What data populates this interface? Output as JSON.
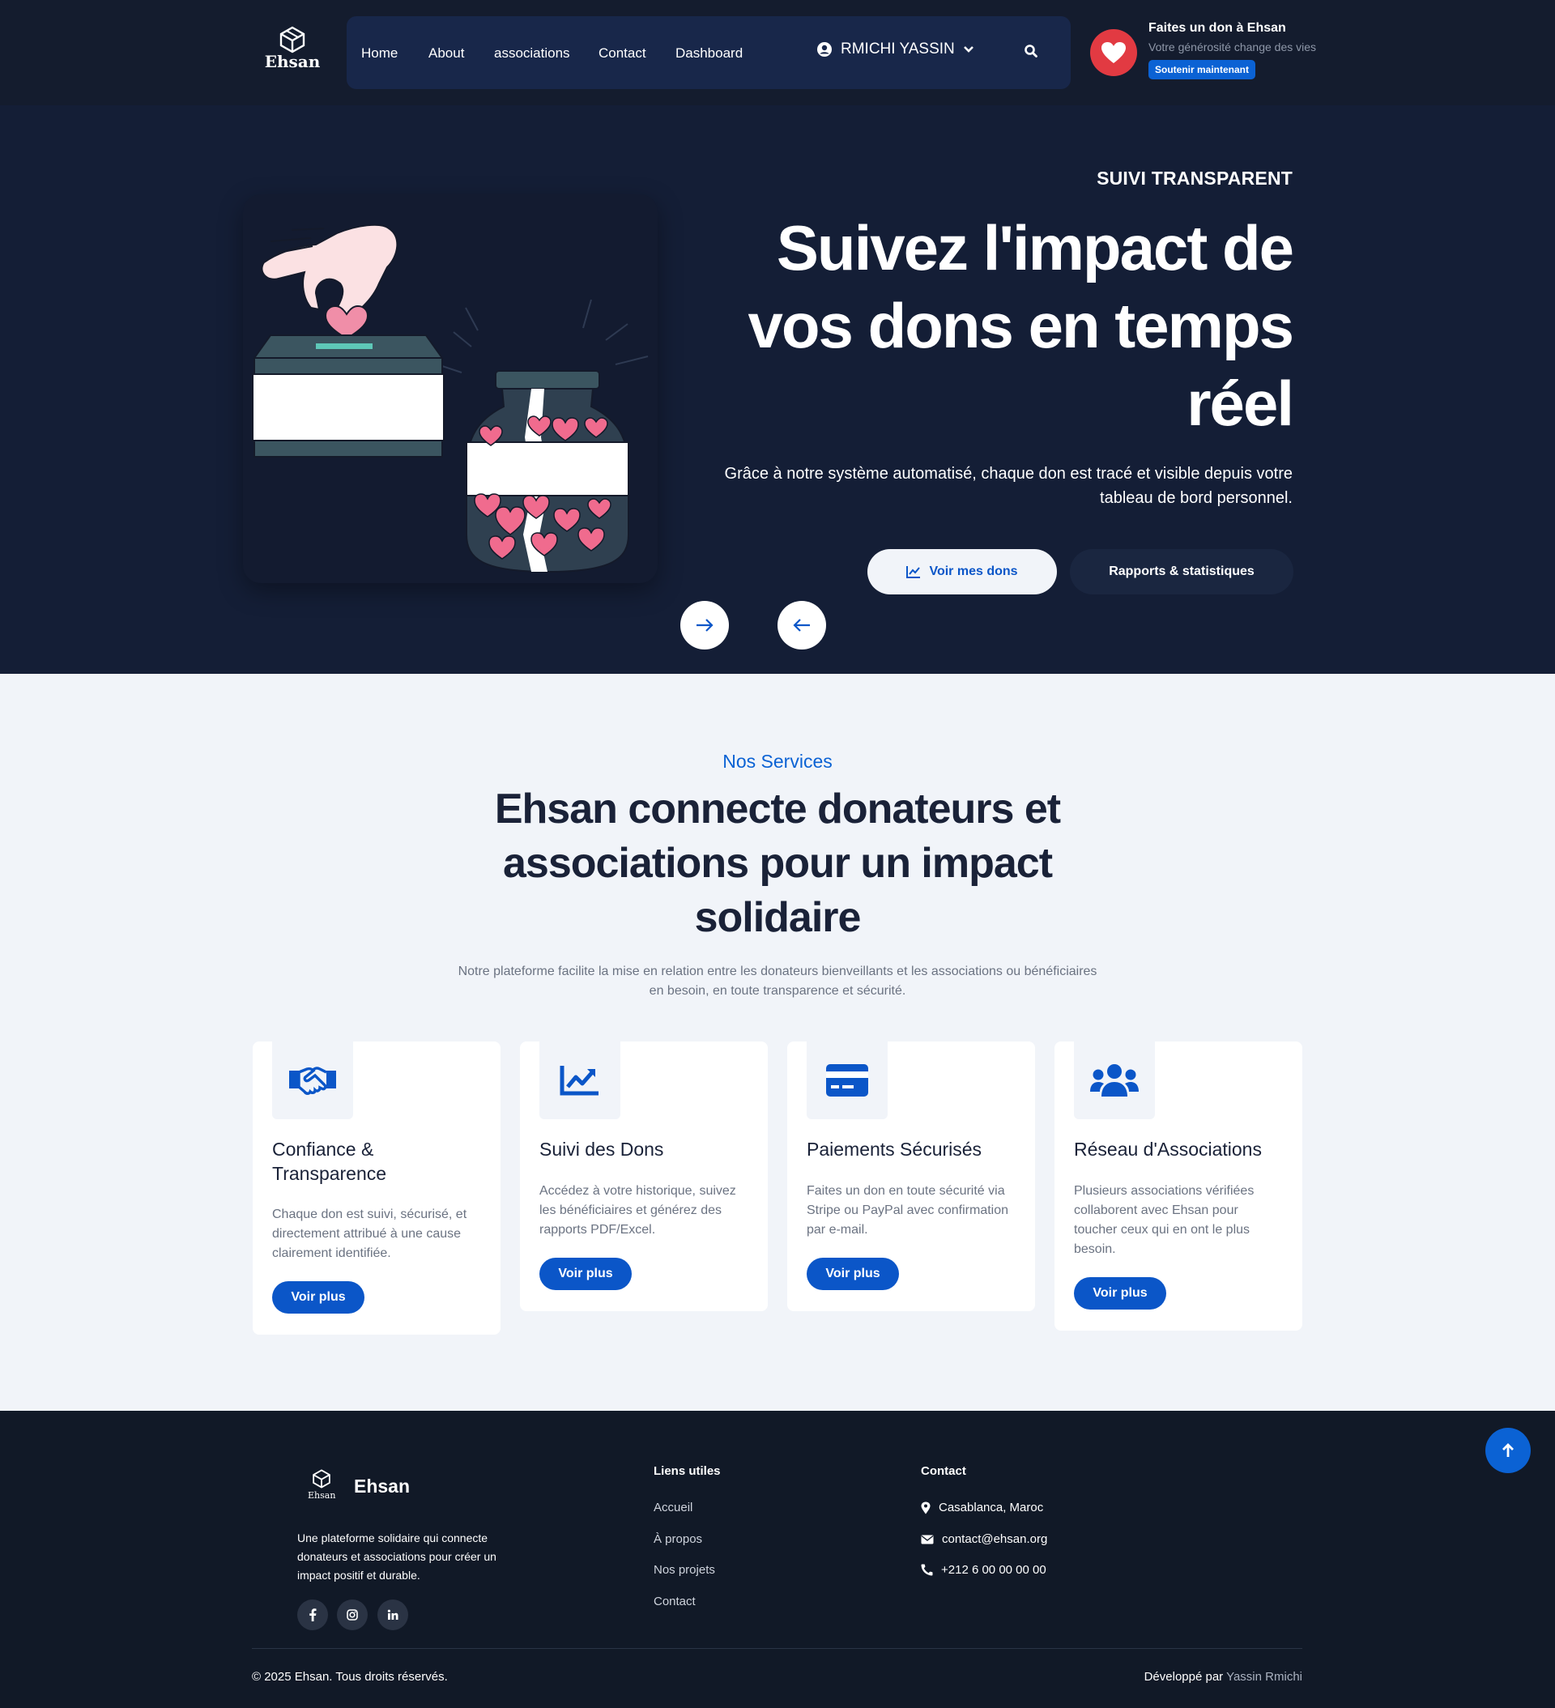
{
  "header": {
    "logo_text": "Ehsan",
    "nav": [
      "Home",
      "About",
      "associations",
      "Contact",
      "Dashboard"
    ],
    "user_name": "RMICHI YASSIN",
    "donate": {
      "title": "Faites un don à Ehsan",
      "subtitle": "Votre générosité change des vies",
      "button": "Soutenir maintenant"
    }
  },
  "hero": {
    "kicker": "SUIVI TRANSPARENT",
    "title": "Suivez l'impact de vos dons en temps réel",
    "text": "Grâce à notre système automatisé, chaque don est tracé et visible depuis votre tableau de bord personnel.",
    "btn_primary": "Voir mes dons",
    "btn_secondary": "Rapports & statistiques"
  },
  "services": {
    "kicker": "Nos Services",
    "title": "Ehsan connecte donateurs et associations pour un impact solidaire",
    "lead": "Notre plateforme facilite la mise en relation entre les donateurs bienveillants et les associations ou bénéficiaires en besoin, en toute transparence et sécurité.",
    "cards": [
      {
        "icon": "handshake-icon",
        "title": "Confiance & Transparence",
        "text": "Chaque don est suivi, sécurisé, et directement attribué à une cause clairement identifiée.",
        "button": "Voir plus"
      },
      {
        "icon": "chart-line-icon",
        "title": "Suivi des Dons",
        "text": "Accédez à votre historique, suivez les bénéficiaires et générez des rapports PDF/Excel.",
        "button": "Voir plus"
      },
      {
        "icon": "credit-card-icon",
        "title": "Paiements Sécurisés",
        "text": "Faites un don en toute sécurité via Stripe ou PayPal avec confirmation par e-mail.",
        "button": "Voir plus"
      },
      {
        "icon": "users-icon",
        "title": "Réseau d'Associations",
        "text": "Plusieurs associations vérifiées collaborent avec Ehsan pour toucher ceux qui en ont le plus besoin.",
        "button": "Voir plus"
      }
    ]
  },
  "footer": {
    "brand": "Ehsan",
    "logo_text": "Ehsan",
    "description": "Une plateforme solidaire qui connecte donateurs et associations pour créer un impact positif et durable.",
    "links_title": "Liens utiles",
    "links": [
      "Accueil",
      "À propos",
      "Nos projets",
      "Contact"
    ],
    "contact_title": "Contact",
    "address": "Casablanca, Maroc",
    "email": "contact@ehsan.org",
    "phone": "+212 6 00 00 00 00",
    "copyright": "© 2025 Ehsan. Tous droits réservés.",
    "dev_label": "Développé par",
    "dev_name": "Yassin Rmichi"
  },
  "colors": {
    "header_bg": "#141c2e",
    "nav_bg": "#18274a",
    "hero_bg": "#141e36",
    "accent": "#0b62d4",
    "heart": "#e23a42",
    "footer_bg": "#111927"
  }
}
